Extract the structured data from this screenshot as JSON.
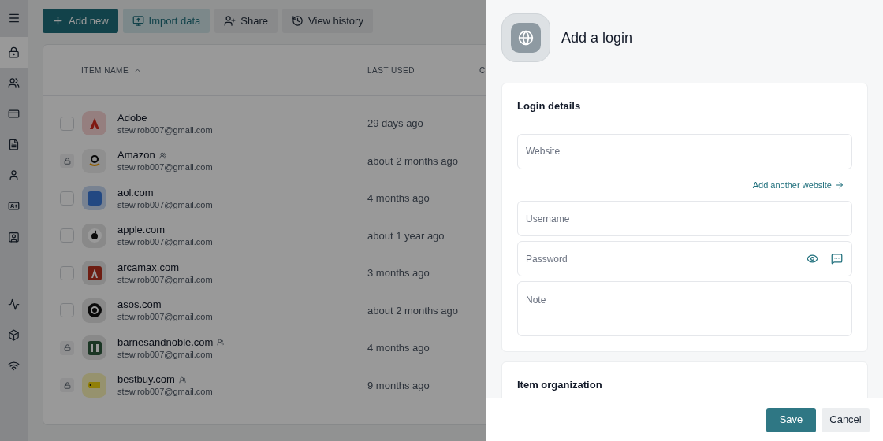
{
  "toolbar": [
    {
      "label": "Add new",
      "kind": "add"
    },
    {
      "label": "Import data",
      "kind": "import"
    },
    {
      "label": "Share",
      "kind": "share"
    },
    {
      "label": "View history",
      "kind": "history"
    }
  ],
  "sidebar": {
    "items": [
      {
        "kind": "lock",
        "selected": true
      },
      {
        "kind": "people",
        "selected": false
      },
      {
        "kind": "card",
        "selected": false
      },
      {
        "kind": "document",
        "selected": false
      },
      {
        "kind": "person",
        "selected": false
      },
      {
        "kind": "id",
        "selected": false
      },
      {
        "kind": "contact",
        "selected": false
      },
      {
        "kind": "activity",
        "selected": false
      },
      {
        "kind": "cube",
        "selected": false
      },
      {
        "kind": "wifi",
        "selected": false
      }
    ]
  },
  "table": {
    "columns": [
      {
        "label": "ITEM NAME",
        "sorted": true
      },
      {
        "label": "LAST USED",
        "sorted": false
      },
      {
        "label": "C",
        "sorted": false
      }
    ],
    "rows": [
      {
        "name": "Adobe",
        "username": "stew.rob007@gmail.com",
        "last_used": "29 days ago",
        "kind": "adobe",
        "locked": false,
        "shared": false
      },
      {
        "name": "Amazon",
        "username": "stew.rob007@gmail.com",
        "last_used": "about 2 months ago",
        "kind": "amazon",
        "locked": true,
        "shared": true
      },
      {
        "name": "aol.com",
        "username": "stew.rob007@gmail.com",
        "last_used": "4 months ago",
        "kind": "aol",
        "locked": false,
        "shared": false
      },
      {
        "name": "apple.com",
        "username": "stew.rob007@gmail.com",
        "last_used": "about 1 year ago",
        "kind": "apple",
        "locked": false,
        "shared": false
      },
      {
        "name": "arcamax.com",
        "username": "stew.rob007@gmail.com",
        "last_used": "3 months ago",
        "kind": "arcamax",
        "locked": false,
        "shared": false
      },
      {
        "name": "asos.com",
        "username": "stew.rob007@gmail.com",
        "last_used": "about 2 months ago",
        "kind": "asos",
        "locked": false,
        "shared": false
      },
      {
        "name": "barnesandnoble.com",
        "username": "stew.rob007@gmail.com",
        "last_used": "4 months ago",
        "kind": "bn",
        "locked": true,
        "shared": true
      },
      {
        "name": "bestbuy.com",
        "username": "stew.rob007@gmail.com",
        "last_used": "9 months ago",
        "kind": "bestbuy",
        "locked": true,
        "shared": true
      }
    ]
  },
  "panel": {
    "title": "Add a login",
    "sections": [
      {
        "title": "Login details",
        "items": [
          {
            "kind": "field",
            "placeholder": "Website"
          },
          {
            "kind": "link",
            "label": "Add another website"
          },
          {
            "kind": "field",
            "placeholder": "Username"
          },
          {
            "kind": "password",
            "placeholder": "Password"
          },
          {
            "kind": "note",
            "placeholder": "Note"
          }
        ]
      },
      {
        "title": "Item organization"
      }
    ],
    "buttons": [
      {
        "label": "Save",
        "kind": "primary"
      },
      {
        "label": "Cancel",
        "kind": "secondary"
      }
    ]
  }
}
